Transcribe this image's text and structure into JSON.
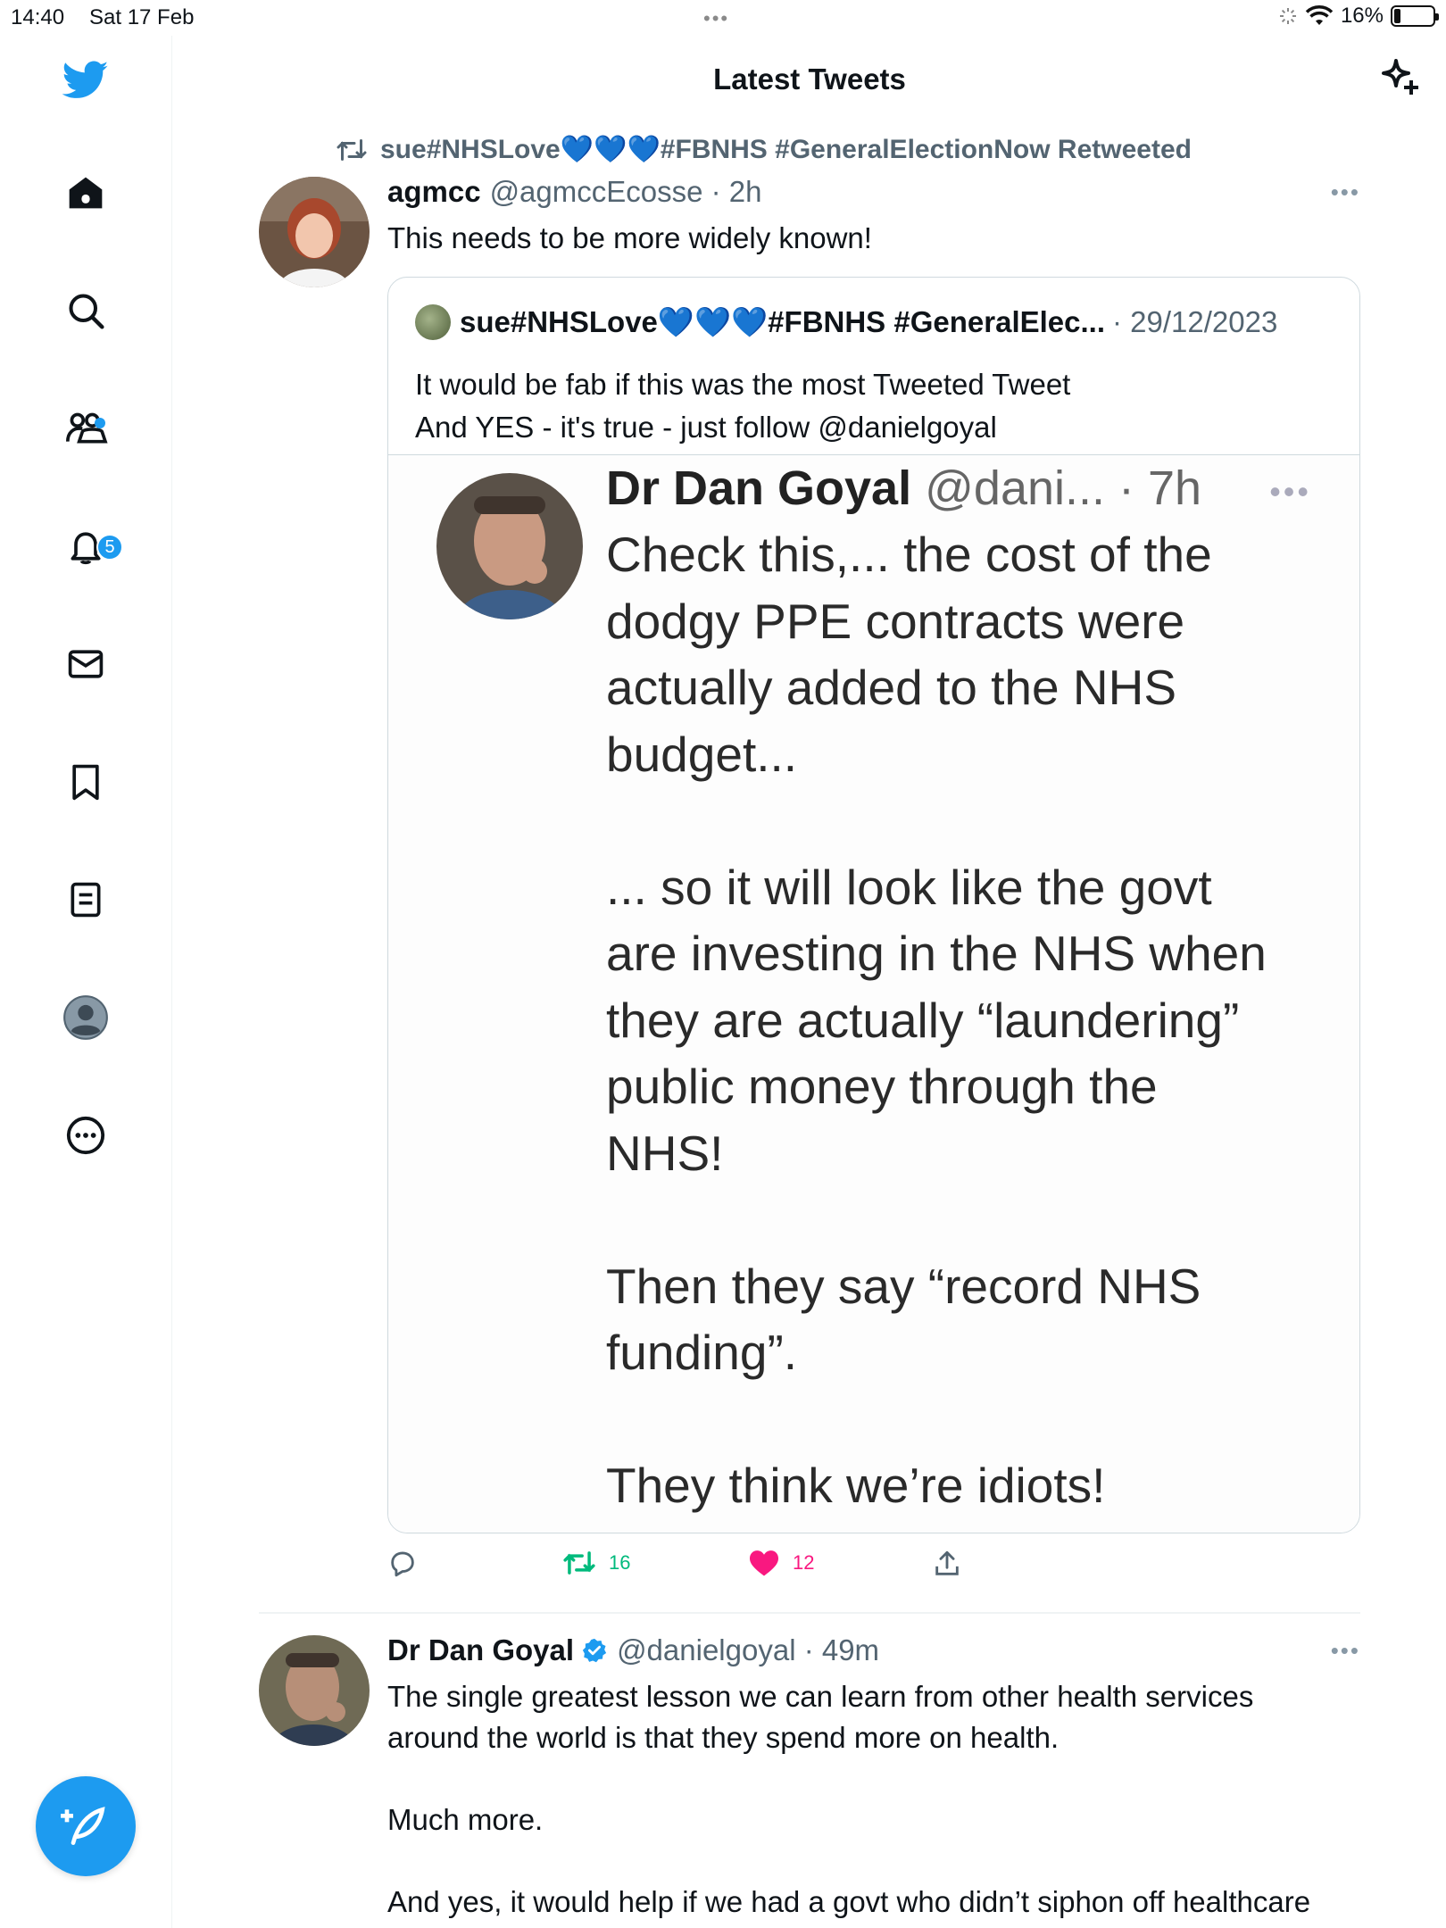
{
  "status_bar": {
    "time": "14:40",
    "date": "Sat 17 Feb",
    "battery": "16%",
    "battery_level": 0.16
  },
  "sidebar": {
    "items": [
      {
        "name": "home",
        "icon": "home-icon"
      },
      {
        "name": "explore",
        "icon": "search-icon"
      },
      {
        "name": "communities",
        "icon": "communities-icon"
      },
      {
        "name": "notifications",
        "icon": "bell-icon",
        "badge": "5"
      },
      {
        "name": "messages",
        "icon": "mail-icon"
      },
      {
        "name": "bookmarks",
        "icon": "bookmark-icon"
      },
      {
        "name": "lists",
        "icon": "list-icon"
      },
      {
        "name": "profile",
        "icon": "avatar-icon"
      },
      {
        "name": "more",
        "icon": "more-circle-icon"
      }
    ]
  },
  "header": {
    "title": "Latest Tweets"
  },
  "tweet1": {
    "retweeted_by": "sue#NHSLove💙💙💙#FBNHS #GeneralElectionNow Retweeted",
    "name": "agmcc",
    "handle_time": "@agmccEcosse · 2h",
    "text": "This needs to be more widely known!",
    "quote": {
      "name": "sue#NHSLove💙💙💙#FBNHS #GeneralElec...",
      "date": "· 29/12/2023",
      "text": "It would be fab if this was the most Tweeted Tweet\nAnd YES - it's true - just follow @danielgoyal",
      "media": {
        "name": "Dr Dan Goyal",
        "handle_time": "@dani... · 7h",
        "text": "Check this,... the cost of the\ndodgy PPE contracts were\nactually added to the NHS\nbudget...\n\n... so it will look like the govt\nare investing in the NHS when\nthey are actually “laundering”\npublic money through the\nNHS!\n\nThen they say “record NHS\nfunding”.\n\nThey think we’re idiots!"
      }
    },
    "actions": {
      "retweets": "16",
      "likes": "12"
    }
  },
  "tweet2": {
    "name": "Dr Dan Goyal",
    "handle_time": "@danielgoyal · 49m",
    "text": "The single greatest lesson we can learn from other health services\naround the world is that they spend more on health.\n\nMuch more.\n\nAnd yes, it would help if we had a govt who didn’t siphon off healthcare"
  },
  "colors": {
    "accent": "#1d9bf0",
    "retweet_green": "#00ba7c",
    "like_pink": "#f91880",
    "secondary_text": "#536471"
  }
}
